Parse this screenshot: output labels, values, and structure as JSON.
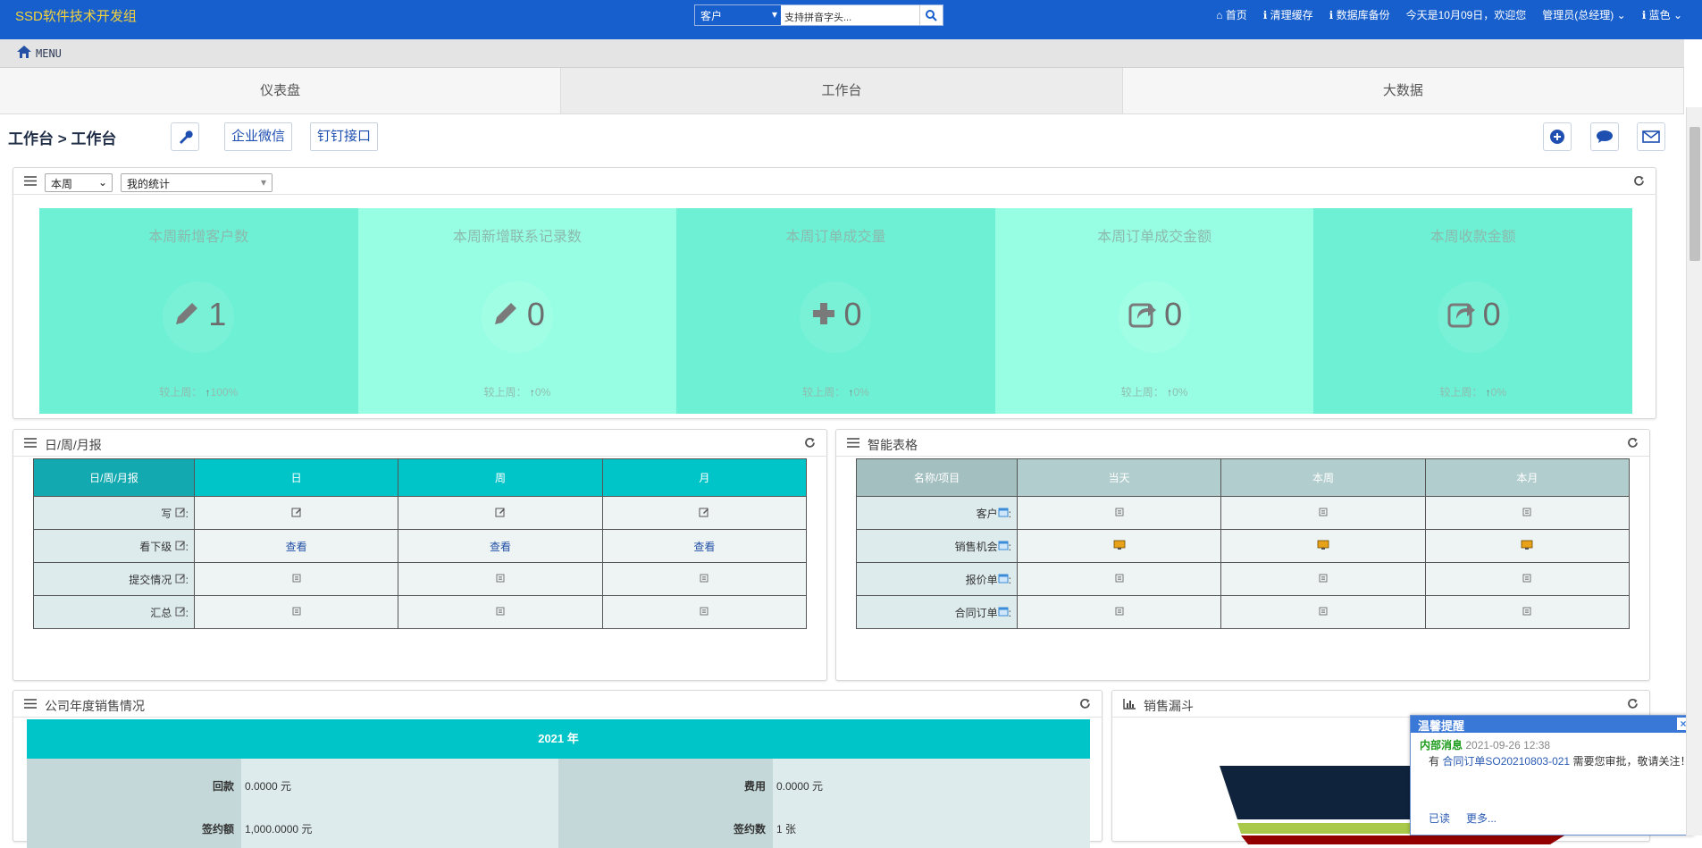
{
  "topbar": {
    "brand": "SSD软件技术开发组",
    "search_type": "客户",
    "search_placeholder": "支持拼音字头...",
    "nav": [
      "首页",
      "清理缓存",
      "数据库备份",
      "今天是10月09日，欢迎您",
      "管理员(总经理)",
      "蓝色"
    ]
  },
  "menubar": {
    "label": "MENU"
  },
  "tabs": [
    "仪表盘",
    "工作台",
    "大数据"
  ],
  "crumb": {
    "path": "工作台 > 工作台",
    "btn_wechat": "企业微信",
    "btn_dingtalk": "钉钉接口"
  },
  "stats_panel": {
    "period": "本周",
    "scope": "我的统计",
    "cards": [
      {
        "title": "本周新增客户数",
        "value": "1",
        "compare": "较上周：",
        "change": "100%",
        "icon": "pencil-icon",
        "color": "#6ef0d4"
      },
      {
        "title": "本周新增联系记录数",
        "value": "0",
        "compare": "较上周：",
        "change": "0%",
        "icon": "pencil-icon",
        "color": "#98fee3"
      },
      {
        "title": "本周订单成交量",
        "value": "0",
        "compare": "较上周：",
        "change": "0%",
        "icon": "plus-icon",
        "color": "#6ef0d4"
      },
      {
        "title": "本周订单成交金额",
        "value": "0",
        "compare": "较上周：",
        "change": "0%",
        "icon": "share-icon",
        "color": "#98fee3"
      },
      {
        "title": "本周收款金额",
        "value": "0",
        "compare": "较上周：",
        "change": "0%",
        "icon": "share-icon",
        "color": "#6ef0d4"
      }
    ]
  },
  "report_panel": {
    "title": "日/周/月报",
    "headers": [
      "日/周/月报",
      "日",
      "周",
      "月"
    ],
    "rows": [
      "写",
      "看下级",
      "提交情况",
      "汇总"
    ],
    "view_label": "查看"
  },
  "smart_panel": {
    "title": "智能表格",
    "headers": [
      "名称/项目",
      "当天",
      "本周",
      "本月"
    ],
    "rows": [
      "客户",
      "销售机会",
      "报价单",
      "合同订单"
    ]
  },
  "sales_panel": {
    "title": "公司年度销售情况",
    "year": "2021 年",
    "items": [
      {
        "label": "回款",
        "value": "0.0000 元"
      },
      {
        "label": "费用",
        "value": "0.0000 元"
      },
      {
        "label": "签约额",
        "value": "1,000.0000 元"
      },
      {
        "label": "签约数",
        "value": "1 张"
      }
    ]
  },
  "funnel_panel": {
    "title": "销售漏斗"
  },
  "notice": {
    "title": "温馨提醒",
    "kind": "内部消息",
    "time": "2021-09-26 12:38",
    "prefix": "有",
    "link": "合同订单SO20210803-021",
    "suffix": "需要您审批，敬请关注！",
    "read": "已读",
    "more": "更多..."
  }
}
